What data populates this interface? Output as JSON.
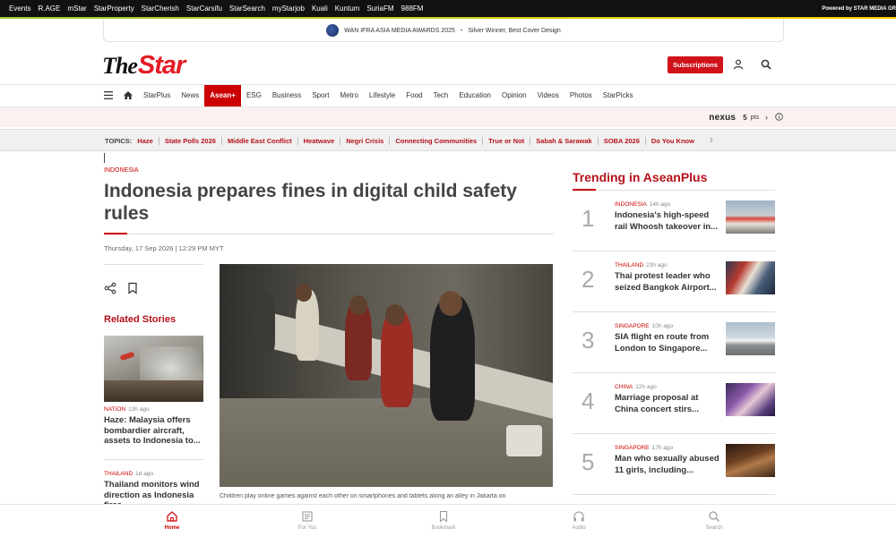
{
  "topbar": {
    "links": [
      "Events",
      "R.AGE",
      "mStar",
      "StarProperty",
      "StarCherish",
      "StarCarsifu",
      "StarSearch",
      "myStarjob",
      "Kuali",
      "Kuntum",
      "SuriaFM",
      "988FM"
    ],
    "powered": "Powered by STAR MEDIA GR"
  },
  "award": {
    "title": "WAN IFRA ASIA MEDIA AWARDS 2025",
    "separator": "•",
    "subtitle": "Silver Winner, Best Cover Design"
  },
  "header": {
    "logo_the": "The",
    "logo_star": "Star",
    "subscribe_label": "Subscriptions",
    "icons": [
      "user-icon",
      "search-icon"
    ]
  },
  "nav": {
    "items": [
      {
        "label": "StarPlus"
      },
      {
        "label": "News"
      },
      {
        "label": "Asean+",
        "active": true
      },
      {
        "label": "ESG"
      },
      {
        "label": "Business"
      },
      {
        "label": "Sport"
      },
      {
        "label": "Metro"
      },
      {
        "label": "Lifestyle"
      },
      {
        "label": "Food"
      },
      {
        "label": "Tech"
      },
      {
        "label": "Education"
      },
      {
        "label": "Opinion"
      },
      {
        "label": "Videos"
      },
      {
        "label": "Photos"
      },
      {
        "label": "StarPicks"
      }
    ]
  },
  "nexus": {
    "brand": "nexus",
    "points": "5",
    "points_unit": "pts"
  },
  "topics": {
    "label": "TOPICS:",
    "items": [
      "Haze",
      "State Polls 2026",
      "Middle East Conflict",
      "Heatwave",
      "Negri Crisis",
      "Connecting Communities",
      "True or Not",
      "Sabah & Sarawak",
      "SOBA 2026",
      "Do You Know"
    ]
  },
  "article": {
    "section": "INDONESIA",
    "headline": "Indonesia prepares fines in digital child safety rules",
    "date": "Thursday, 17 Sep 2026 | 12:29 PM MYT",
    "caption": "Children play online games against each other on smartphones and tablets along an alley in Jakarta on"
  },
  "related": {
    "title": "Related Stories",
    "stories": [
      {
        "category": "NATION",
        "time": "13h ago",
        "headline": "Haze: Malaysia offers bombardier aircraft, assets to Indonesia to..."
      },
      {
        "category": "THAILAND",
        "time": "1d ago",
        "headline": "Thailand monitors wind direction as Indonesia fires..."
      }
    ]
  },
  "trending": {
    "title": "Trending in AseanPlus",
    "items": [
      {
        "rank": "1",
        "category": "INDONESIA",
        "time": "14h ago",
        "title": "Indonesia's high-speed rail Whoosh takeover in..."
      },
      {
        "rank": "2",
        "category": "THAILAND",
        "time": "23h ago",
        "title": "Thai protest leader who seized Bangkok Airport..."
      },
      {
        "rank": "3",
        "category": "SINGAPORE",
        "time": "10h ago",
        "title": "SIA flight en route from London to Singapore..."
      },
      {
        "rank": "4",
        "category": "CHINA",
        "time": "12h ago",
        "title": "Marriage proposal at China concert stirs..."
      },
      {
        "rank": "5",
        "category": "SINGAPORE",
        "time": "17h ago",
        "title": "Man who sexually abused 11 girls, including..."
      }
    ]
  },
  "bottom_nav": {
    "items": [
      {
        "label": "Home",
        "icon": "home-icon",
        "active": true
      },
      {
        "label": "For You",
        "icon": "news-icon"
      },
      {
        "label": "Bookmark",
        "icon": "bookmark-icon"
      },
      {
        "label": "Audio",
        "icon": "headphones-icon"
      },
      {
        "label": "Search",
        "icon": "search-icon"
      }
    ]
  },
  "colors": {
    "brand_red": "#c00000",
    "topbar_bg": "#111111"
  }
}
